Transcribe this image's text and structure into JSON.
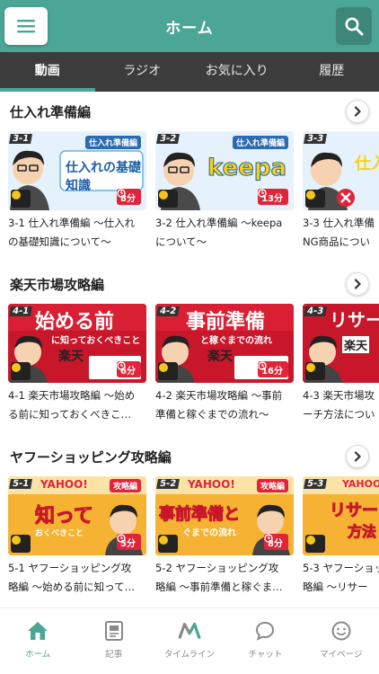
{
  "header": {
    "title": "ホーム",
    "menu_icon": "hamburger-menu-icon",
    "search_icon": "search-icon",
    "accent": "#4ba695"
  },
  "tabs": [
    {
      "label": "動画",
      "active": true
    },
    {
      "label": "ラジオ",
      "active": false
    },
    {
      "label": "お気に入り",
      "active": false
    },
    {
      "label": "履歴",
      "active": false
    }
  ],
  "sections": [
    {
      "title": "仕入れ準備編",
      "cards": [
        {
          "num": "3-1",
          "tag": "仕入れ準備編",
          "main": "仕入れの基礎知識",
          "duration": "8分",
          "title_line1": "3-1 仕入れ準備編 ～仕入れ",
          "title_line2": "の基礎知識について～"
        },
        {
          "num": "3-2",
          "tag": "仕入れ準備編",
          "main": "keepa",
          "duration": "13分",
          "title_line1": "3-2 仕入れ準備編 ～keepa",
          "title_line2": "について～"
        },
        {
          "num": "3-3",
          "tag": "仕入",
          "main": "仕入",
          "duration": "",
          "title_line1": "3-3 仕入れ準備",
          "title_line2": "NG商品につい"
        }
      ]
    },
    {
      "title": "楽天市場攻略編",
      "cards": [
        {
          "num": "4-1",
          "tag": "",
          "main": "始める前",
          "sub": "に知っておくべきこと",
          "logo": "楽天",
          "duration": "6分",
          "title_line1": "4-1 楽天市場攻略編 ～始め",
          "title_line2": "る前に知っておくべきこ…"
        },
        {
          "num": "4-2",
          "tag": "",
          "main": "事前準備",
          "sub": "と稼ぐまでの流れ",
          "logo": "楽天",
          "duration": "16分",
          "title_line1": "4-2 楽天市場攻略編 ～事前",
          "title_line2": "準備と稼ぐまでの流れ～"
        },
        {
          "num": "4-3",
          "tag": "",
          "main": "リサー",
          "sub": "",
          "logo": "楽天",
          "duration": "",
          "title_line1": "4-3 楽天市場攻",
          "title_line2": "ーチ方法につい"
        }
      ]
    },
    {
      "title": "ヤフーショッピング攻略編",
      "cards": [
        {
          "num": "5-1",
          "tag": "攻略編",
          "main": "知って",
          "sub": "おくべきこと",
          "logo": "YAHOO!",
          "duration": "5分",
          "title_line1": "5-1 ヤフーショッピング攻",
          "title_line2": "略編 ～始める前に知って…"
        },
        {
          "num": "5-2",
          "tag": "攻略編",
          "main": "事前準備と",
          "sub": "ぐまでの流れ",
          "logo": "YAHOO!",
          "duration": "8分",
          "title_line1": "5-2 ヤフーショッピング攻",
          "title_line2": "略編 ～事前準備と稼ぐま…"
        },
        {
          "num": "5-3",
          "tag": "",
          "main": "リサー",
          "sub": "方法",
          "logo": "YAHOO!",
          "duration": "",
          "title_line1": "5-3 ヤフーショッ",
          "title_line2": "略編 ～リサー"
        }
      ]
    }
  ],
  "bottom_nav": [
    {
      "label": "ホーム",
      "icon": "home-icon",
      "active": true
    },
    {
      "label": "記事",
      "icon": "article-icon",
      "active": false
    },
    {
      "label": "タイムライン",
      "icon": "timeline-logo-icon",
      "active": false
    },
    {
      "label": "チャット",
      "icon": "chat-bubble-icon",
      "active": false
    },
    {
      "label": "マイページ",
      "icon": "smiley-face-icon",
      "active": false
    }
  ]
}
